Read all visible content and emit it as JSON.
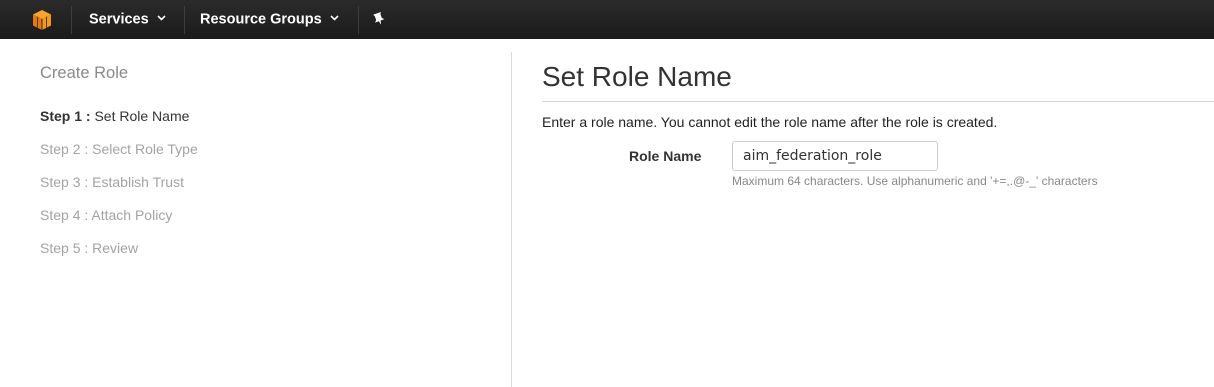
{
  "topbar": {
    "logo_icon": "aws-cube-icon",
    "brand_color": "#f7981d",
    "nav": {
      "services_label": "Services",
      "resource_groups_label": "Resource Groups"
    },
    "pin_icon": "pin-icon"
  },
  "sidebar": {
    "title": "Create Role",
    "steps": [
      {
        "prefix": "Step 1 :",
        "label": "Set Role Name",
        "active": true
      },
      {
        "prefix": "Step 2 :",
        "label": "Select Role Type",
        "active": false
      },
      {
        "prefix": "Step 3 :",
        "label": "Establish Trust",
        "active": false
      },
      {
        "prefix": "Step 4 :",
        "label": "Attach Policy",
        "active": false
      },
      {
        "prefix": "Step 5 :",
        "label": "Review",
        "active": false
      }
    ]
  },
  "main": {
    "heading": "Set Role Name",
    "intro": "Enter a role name. You cannot edit the role name after the role is created.",
    "role_name": {
      "label": "Role Name",
      "value": "aim_federation_role",
      "hint": "Maximum 64 characters. Use alphanumeric and '+=,.@-_' characters"
    }
  }
}
